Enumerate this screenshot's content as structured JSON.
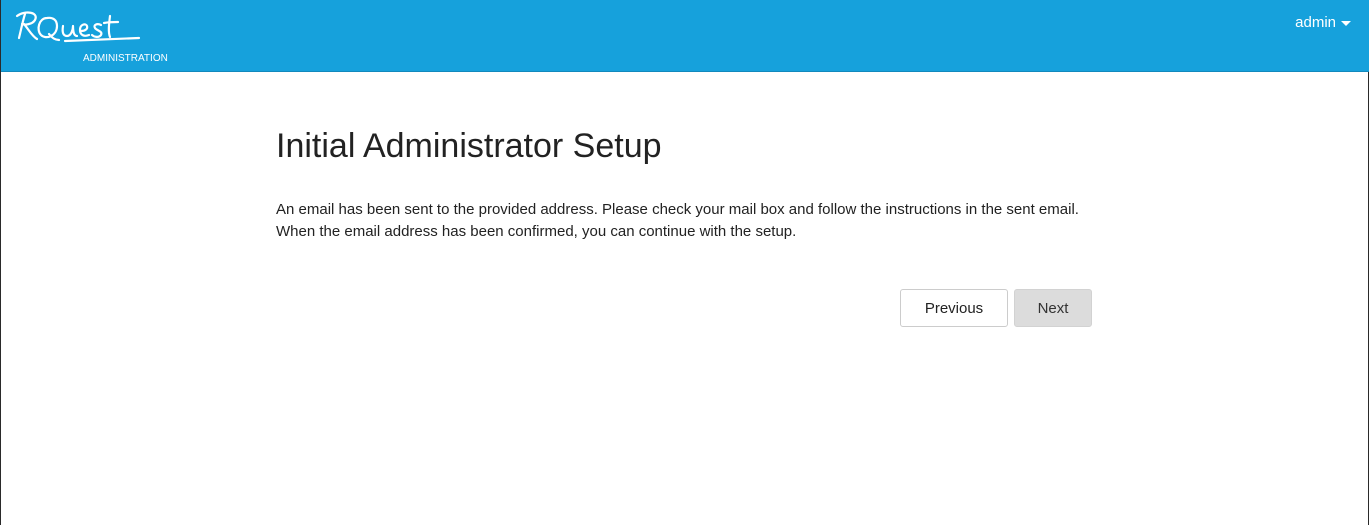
{
  "header": {
    "logo_text": "RQuest",
    "logo_subtitle": "ADMINISTRATION",
    "user_label": "admin",
    "bar_color": "#16a1dc",
    "user_menu_icon": "caret-down-icon"
  },
  "main": {
    "title": "Initial Administrator Setup",
    "message": "An email has been sent to the provided address. Please check your mail box and follow the instructions in the sent email. When the email address has been confirmed, you can continue with the setup."
  },
  "actions": {
    "previous_label": "Previous",
    "next_label": "Next"
  }
}
